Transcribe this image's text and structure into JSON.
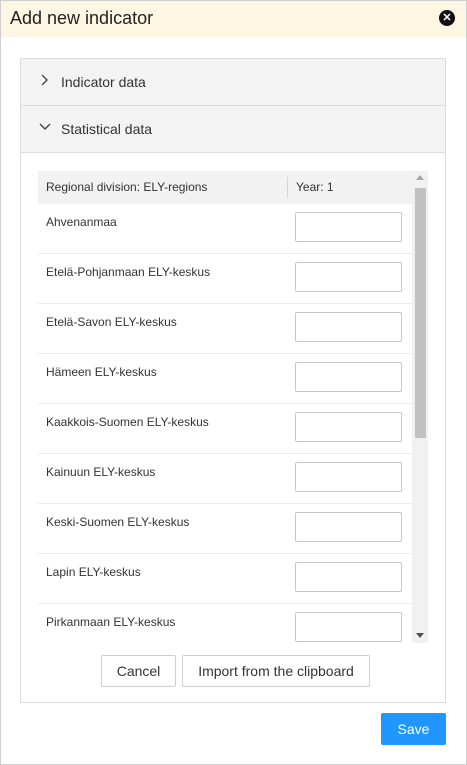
{
  "dialog": {
    "title": "Add new indicator",
    "close_icon": "close-icon"
  },
  "accordion": {
    "panels": [
      {
        "label": "Indicator data",
        "state": "collapsed",
        "icon": "chevron-right-icon"
      },
      {
        "label": "Statistical data",
        "state": "expanded",
        "icon": "chevron-down-icon"
      }
    ]
  },
  "table": {
    "headers": [
      "Regional division: ELY-regions",
      "Year: 1"
    ],
    "rows": [
      {
        "name": "Ahvenanmaa",
        "value": ""
      },
      {
        "name": "Etelä-Pohjanmaan ELY-keskus",
        "value": ""
      },
      {
        "name": "Etelä-Savon ELY-keskus",
        "value": ""
      },
      {
        "name": "Hämeen ELY-keskus",
        "value": ""
      },
      {
        "name": "Kaakkois-Suomen ELY-keskus",
        "value": ""
      },
      {
        "name": "Kainuun ELY-keskus",
        "value": ""
      },
      {
        "name": "Keski-Suomen ELY-keskus",
        "value": ""
      },
      {
        "name": "Lapin ELY-keskus",
        "value": ""
      },
      {
        "name": "Pirkanmaan ELY-keskus",
        "value": ""
      }
    ]
  },
  "buttons": {
    "cancel": "Cancel",
    "import": "Import from the clipboard",
    "save": "Save"
  },
  "colors": {
    "titlebar_bg": "#fdf6e3",
    "save_bg": "#1f97ff"
  }
}
